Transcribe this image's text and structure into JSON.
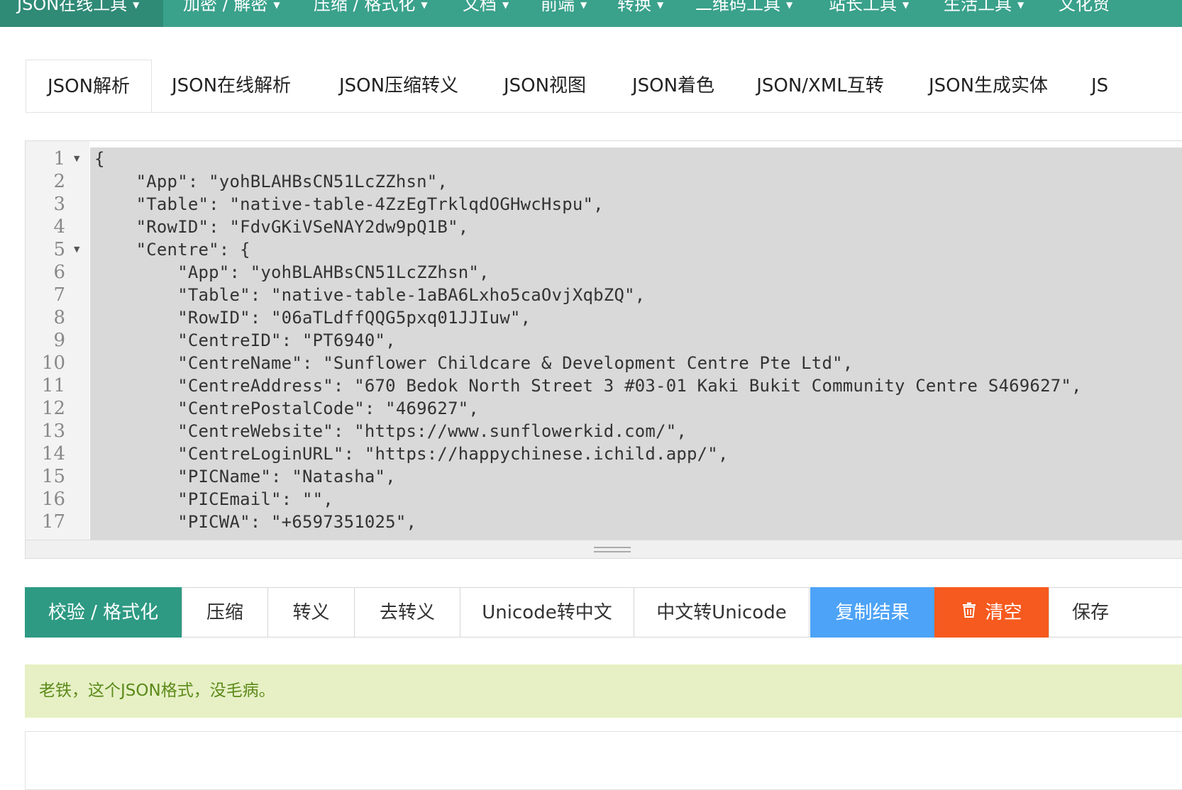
{
  "nav": {
    "items": [
      {
        "label": "JSON在线工具",
        "active": true
      },
      {
        "label": "加密 / 解密"
      },
      {
        "label": "压缩 / 格式化"
      },
      {
        "label": "文档"
      },
      {
        "label": "前端"
      },
      {
        "label": "转换"
      },
      {
        "label": "二维码工具"
      },
      {
        "label": "站长工具"
      },
      {
        "label": "生活工具"
      },
      {
        "label": "文化贸"
      }
    ]
  },
  "tabs": [
    {
      "label": "JSON解析",
      "active": true
    },
    {
      "label": "JSON在线解析"
    },
    {
      "label": "JSON压缩转义"
    },
    {
      "label": "JSON视图"
    },
    {
      "label": "JSON着色"
    },
    {
      "label": "JSON/XML互转"
    },
    {
      "label": "JSON生成实体"
    },
    {
      "label": "JS"
    }
  ],
  "editor": {
    "lines": [
      {
        "n": "1",
        "fold": true,
        "text": "{"
      },
      {
        "n": "2",
        "text": "    \"App\": \"yohBLAHBsCN51LcZZhsn\","
      },
      {
        "n": "3",
        "text": "    \"Table\": \"native-table-4ZzEgTrklqdOGHwcHspu\","
      },
      {
        "n": "4",
        "text": "    \"RowID\": \"FdvGKiVSeNAY2dw9pQ1B\","
      },
      {
        "n": "5",
        "fold": true,
        "text": "    \"Centre\": {"
      },
      {
        "n": "6",
        "text": "        \"App\": \"yohBLAHBsCN51LcZZhsn\","
      },
      {
        "n": "7",
        "text": "        \"Table\": \"native-table-1aBA6Lxho5caOvjXqbZQ\","
      },
      {
        "n": "8",
        "text": "        \"RowID\": \"06aTLdffQQG5pxq01JJIuw\","
      },
      {
        "n": "9",
        "text": "        \"CentreID\": \"PT6940\","
      },
      {
        "n": "10",
        "text": "        \"CentreName\": \"Sunflower Childcare & Development Centre Pte Ltd\","
      },
      {
        "n": "11",
        "text": "        \"CentreAddress\": \"670 Bedok North Street 3 #03-01 Kaki Bukit Community Centre S469627\","
      },
      {
        "n": "12",
        "text": "        \"CentrePostalCode\": \"469627\","
      },
      {
        "n": "13",
        "text": "        \"CentreWebsite\": \"https://www.sunflowerkid.com/\","
      },
      {
        "n": "14",
        "text": "        \"CentreLoginURL\": \"https://happychinese.ichild.app/\","
      },
      {
        "n": "15",
        "text": "        \"PICName\": \"Natasha\","
      },
      {
        "n": "16",
        "text": "        \"PICEmail\": \"\","
      },
      {
        "n": "17",
        "text": "        \"PICWA\": \"+6597351025\","
      }
    ]
  },
  "buttons": [
    {
      "label": "校验 / 格式化",
      "style": "primary"
    },
    {
      "label": "压缩"
    },
    {
      "label": "转义"
    },
    {
      "label": "去转义"
    },
    {
      "label": "Unicode转中文"
    },
    {
      "label": "中文转Unicode"
    },
    {
      "label": "复制结果",
      "style": "blue"
    },
    {
      "label": "清空",
      "style": "orange",
      "icon": "trash-icon"
    },
    {
      "label": "保存"
    }
  ],
  "status": {
    "message": "老铁，这个JSON格式，没毛病。"
  },
  "colors": {
    "nav_bg": "#3aa18b",
    "primary": "#2e9a83",
    "blue": "#4da3f7",
    "orange": "#f65a1e",
    "success_bg": "#e6f0c4",
    "success_text": "#5c8a1a"
  }
}
